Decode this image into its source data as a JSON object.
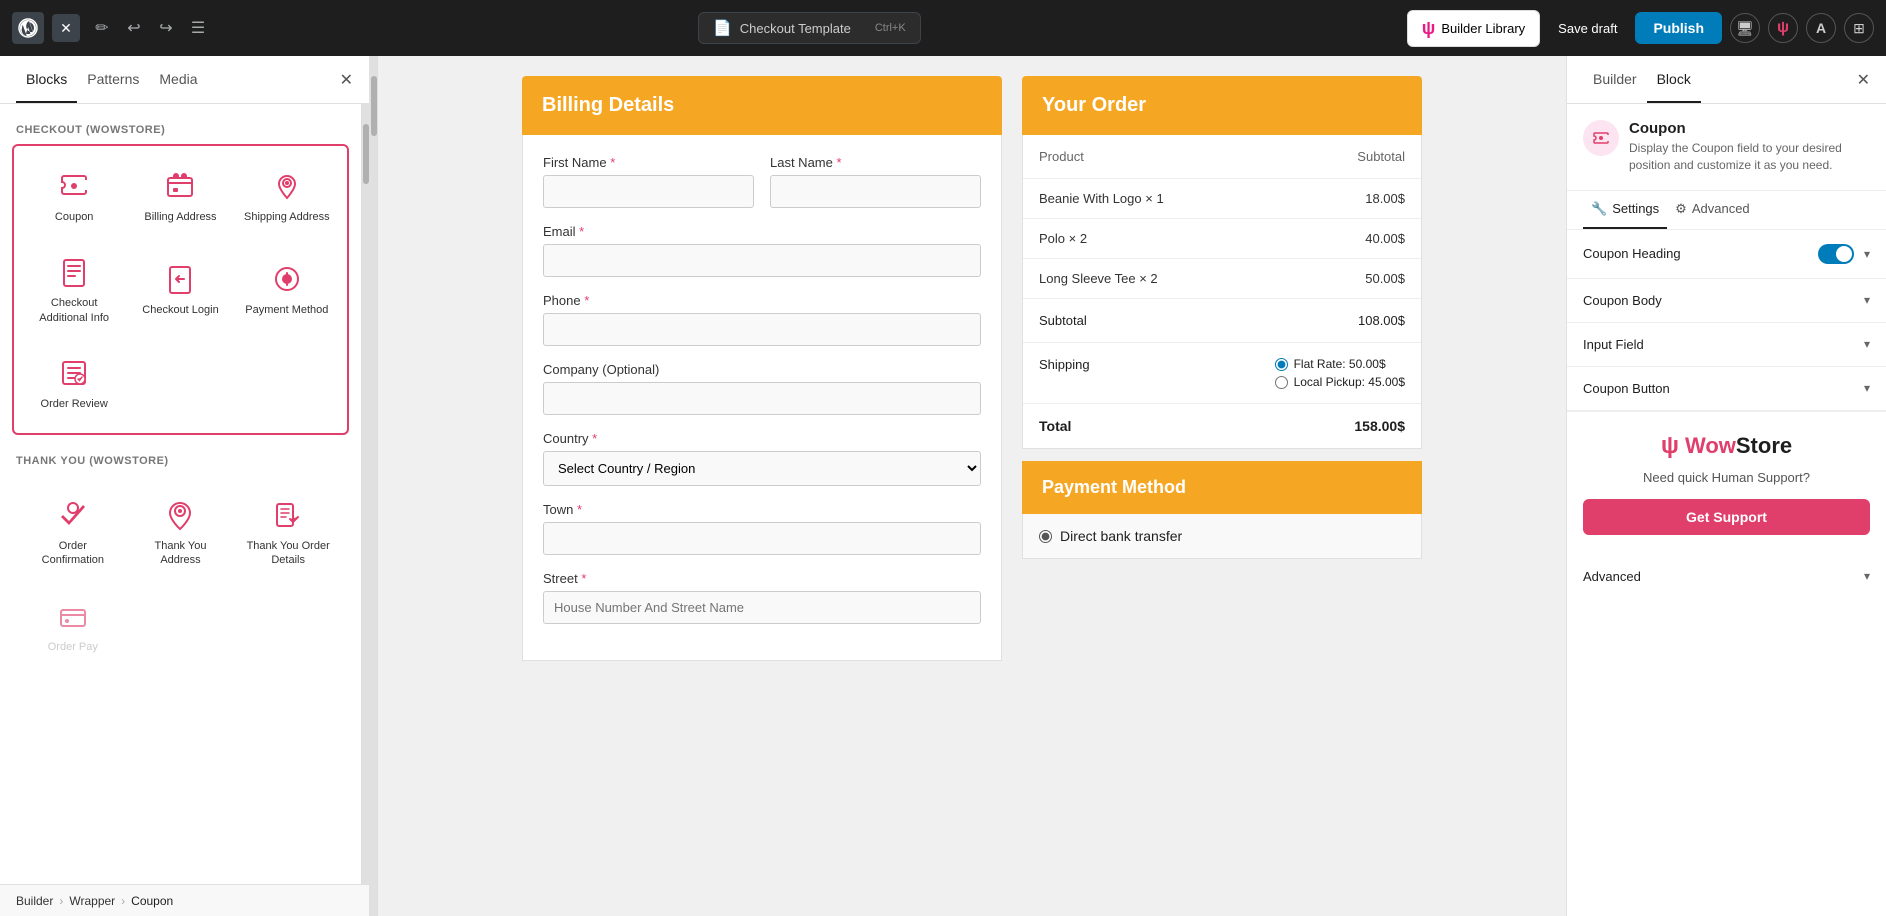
{
  "topbar": {
    "title": "Checkout Template",
    "shortcut": "Ctrl+K",
    "builder_library_label": "Builder Library",
    "save_draft_label": "Save draft",
    "publish_label": "Publish",
    "w_logo": "ψ"
  },
  "left_panel": {
    "tabs": [
      "Blocks",
      "Patterns",
      "Media"
    ],
    "active_tab": "Blocks",
    "sections": {
      "checkout": {
        "label": "CHECKOUT (WOWSTORE)",
        "items": [
          {
            "id": "coupon",
            "label": "Coupon"
          },
          {
            "id": "billing-address",
            "label": "Billing Address"
          },
          {
            "id": "shipping-address",
            "label": "Shipping Address"
          },
          {
            "id": "checkout-additional",
            "label": "Checkout Additional Info"
          },
          {
            "id": "checkout-login",
            "label": "Checkout Login"
          },
          {
            "id": "payment-method",
            "label": "Payment Method"
          },
          {
            "id": "order-review",
            "label": "Order Review"
          }
        ]
      },
      "thankyou": {
        "label": "THANK YOU (WOWSTORE)",
        "items": [
          {
            "id": "order-confirmation",
            "label": "Order Confirmation"
          },
          {
            "id": "thank-you-address",
            "label": "Thank You Address"
          },
          {
            "id": "thank-you-order-details",
            "label": "Thank You Order Details"
          },
          {
            "id": "order-pay",
            "label": "Order Pay"
          }
        ]
      }
    }
  },
  "canvas": {
    "billing": {
      "header": "Billing Details",
      "fields": [
        {
          "id": "first-name",
          "label": "First Name",
          "required": true,
          "placeholder": ""
        },
        {
          "id": "last-name",
          "label": "Last Name",
          "required": true,
          "placeholder": ""
        },
        {
          "id": "email",
          "label": "Email",
          "required": true,
          "placeholder": ""
        },
        {
          "id": "phone",
          "label": "Phone",
          "required": true,
          "placeholder": ""
        },
        {
          "id": "company",
          "label": "Company (Optional)",
          "required": false,
          "placeholder": ""
        },
        {
          "id": "country",
          "label": "Country",
          "required": true,
          "placeholder": "Select Country / Region"
        },
        {
          "id": "town",
          "label": "Town",
          "required": true,
          "placeholder": ""
        },
        {
          "id": "street",
          "label": "Street",
          "required": true,
          "placeholder": "House Number And Street Name"
        }
      ]
    },
    "order": {
      "header": "Your Order",
      "product_col": "Product",
      "subtotal_col": "Subtotal",
      "items": [
        {
          "name": "Beanie With Logo × 1",
          "price": "18.00$"
        },
        {
          "name": "Polo × 2",
          "price": "40.00$"
        },
        {
          "name": "Long Sleeve Tee × 2",
          "price": "50.00$"
        }
      ],
      "subtotal_label": "Subtotal",
      "subtotal_value": "108.00$",
      "shipping_label": "Shipping",
      "shipping_options": [
        {
          "label": "Flat Rate: 50.00$",
          "selected": true
        },
        {
          "label": "Local Pickup: 45.00$",
          "selected": false
        }
      ],
      "total_label": "Total",
      "total_value": "158.00$",
      "payment_header": "Payment Method",
      "payment_options": [
        {
          "label": "Direct bank transfer",
          "selected": true
        }
      ]
    }
  },
  "right_panel": {
    "tabs": [
      "Builder",
      "Block"
    ],
    "active_tab": "Block",
    "coupon": {
      "title": "Coupon",
      "description": "Display the Coupon field to your desired position and customize it as you need."
    },
    "settings_tabs": [
      "Settings",
      "Advanced"
    ],
    "active_settings_tab": "Settings",
    "accordion_items": [
      {
        "id": "coupon-heading",
        "label": "Coupon Heading",
        "has_toggle": true,
        "toggle_on": true,
        "expanded": false
      },
      {
        "id": "coupon-body",
        "label": "Coupon Body",
        "has_toggle": false,
        "expanded": false
      },
      {
        "id": "input-field",
        "label": "Input Field",
        "has_toggle": false,
        "expanded": false
      },
      {
        "id": "coupon-button",
        "label": "Coupon Button",
        "has_toggle": false,
        "expanded": false
      }
    ],
    "promo": {
      "logo_prefix": "ψ",
      "logo_wow": "Wow",
      "logo_store": "Store",
      "description": "Need quick Human Support?",
      "button_label": "Get Support"
    },
    "advanced_label": "Advanced"
  },
  "breadcrumb": {
    "items": [
      "Builder",
      "Wrapper",
      "Coupon"
    ]
  }
}
